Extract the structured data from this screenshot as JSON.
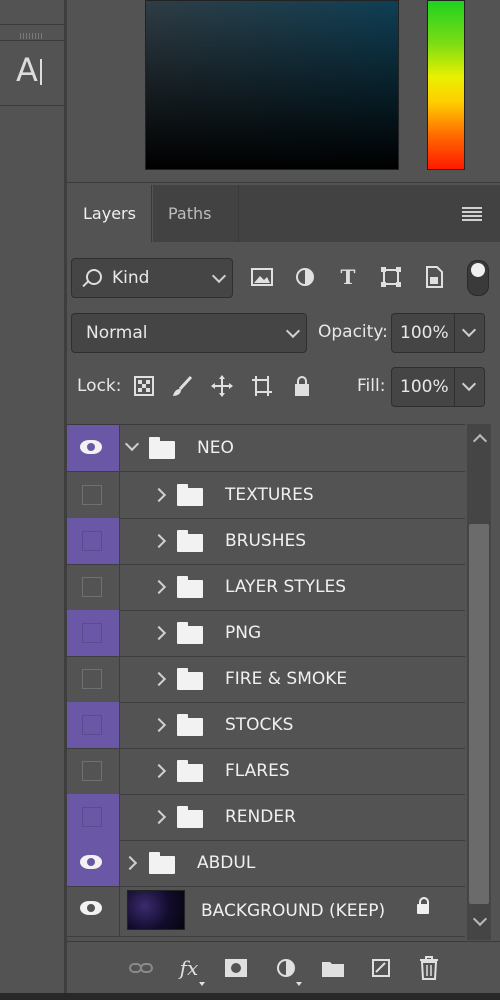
{
  "tools": {
    "text_tool_label": "A"
  },
  "tabs": [
    {
      "label": "Layers",
      "active": true
    },
    {
      "label": "Paths",
      "active": false
    }
  ],
  "filter": {
    "kind_label": "Kind",
    "icons": [
      "image-filter-icon",
      "adjustment-filter-icon",
      "type-filter-icon",
      "shape-filter-icon",
      "smart-object-filter-icon"
    ]
  },
  "blend": {
    "mode": "Normal",
    "opacity_label": "Opacity:",
    "opacity_value": "100%"
  },
  "lock": {
    "label": "Lock:",
    "fill_label": "Fill:",
    "fill_value": "100%"
  },
  "layers": [
    {
      "name": "NEO",
      "type": "group",
      "expanded": true,
      "visible": true,
      "highlight": true,
      "level": 0
    },
    {
      "name": "TEXTURES",
      "type": "group",
      "expanded": false,
      "visible": false,
      "highlight": false,
      "level": 1
    },
    {
      "name": "BRUSHES",
      "type": "group",
      "expanded": false,
      "visible": false,
      "highlight": true,
      "level": 1
    },
    {
      "name": "LAYER STYLES",
      "type": "group",
      "expanded": false,
      "visible": false,
      "highlight": false,
      "level": 1
    },
    {
      "name": "PNG",
      "type": "group",
      "expanded": false,
      "visible": false,
      "highlight": true,
      "level": 1
    },
    {
      "name": "FIRE & SMOKE",
      "type": "group",
      "expanded": false,
      "visible": false,
      "highlight": false,
      "level": 1
    },
    {
      "name": "STOCKS",
      "type": "group",
      "expanded": false,
      "visible": false,
      "highlight": true,
      "level": 1
    },
    {
      "name": "FLARES",
      "type": "group",
      "expanded": false,
      "visible": false,
      "highlight": false,
      "level": 1
    },
    {
      "name": "RENDER",
      "type": "group",
      "expanded": false,
      "visible": false,
      "highlight": true,
      "level": 1
    },
    {
      "name": "ABDUL",
      "type": "group",
      "expanded": false,
      "visible": true,
      "highlight": true,
      "level": 0
    },
    {
      "name": "BACKGROUND (KEEP)",
      "type": "image",
      "visible": true,
      "highlight": false,
      "locked": true,
      "level": 0
    }
  ],
  "bottom_icons": [
    "link-layers-icon",
    "fx-icon",
    "add-mask-icon",
    "adjustment-layer-icon",
    "new-group-icon",
    "new-layer-icon",
    "delete-layer-icon"
  ],
  "colors": {
    "selection_purple": "#6a58a6",
    "panel_bg": "#535353",
    "tab_bar": "#424242"
  }
}
